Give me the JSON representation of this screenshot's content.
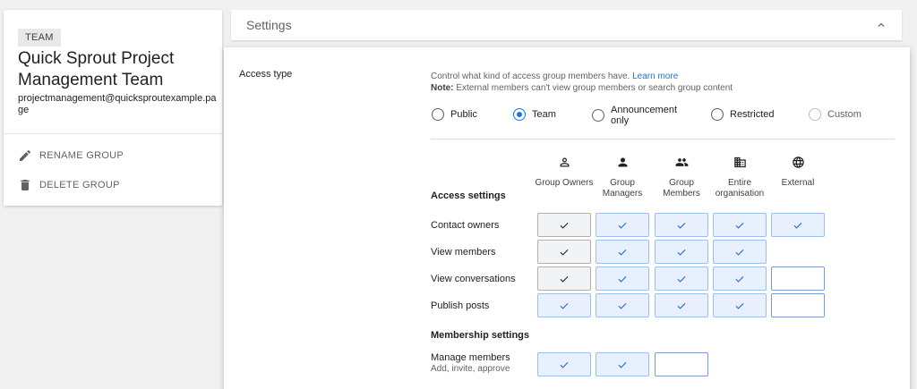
{
  "group": {
    "badge": "TEAM",
    "name": "Quick Sprout Project Management Team",
    "email": "projectmanagement@quicksproutexample.page",
    "actions": [
      {
        "label": "RENAME GROUP",
        "icon": "pencil-icon"
      },
      {
        "label": "DELETE GROUP",
        "icon": "trash-icon"
      }
    ]
  },
  "settings": {
    "title": "Settings",
    "access_type_label": "Access type",
    "description": "Control what kind of access group members have.",
    "learn_more": "Learn more",
    "note_label": "Note:",
    "note_text": "External members can't view group members or search group content",
    "access_options": [
      {
        "label": "Public",
        "selected": false,
        "disabled": false
      },
      {
        "label": "Team",
        "selected": true,
        "disabled": false
      },
      {
        "label": "Announcement only",
        "selected": false,
        "disabled": false
      },
      {
        "label": "Restricted",
        "selected": false,
        "disabled": false
      },
      {
        "label": "Custom",
        "selected": false,
        "disabled": true
      }
    ],
    "columns": [
      {
        "label": "Group Owners",
        "icon": "person-outline-icon"
      },
      {
        "label": "Group Managers",
        "icon": "person-icon"
      },
      {
        "label": "Group Members",
        "icon": "people-icon"
      },
      {
        "label": "Entire organisation",
        "icon": "building-icon"
      },
      {
        "label": "External",
        "icon": "globe-icon"
      }
    ],
    "access_settings_title": "Access settings",
    "access_rows": [
      {
        "label": "Contact owners",
        "cells": [
          "checked-locked",
          "checked",
          "checked",
          "checked",
          "checked"
        ]
      },
      {
        "label": "View members",
        "cells": [
          "checked-locked",
          "checked",
          "checked",
          "checked",
          "none"
        ]
      },
      {
        "label": "View conversations",
        "cells": [
          "checked-locked",
          "checked",
          "checked",
          "checked",
          "empty"
        ]
      },
      {
        "label": "Publish posts",
        "cells": [
          "checked",
          "checked",
          "checked",
          "checked",
          "empty"
        ]
      }
    ],
    "membership_settings_title": "Membership settings",
    "membership_rows": [
      {
        "label": "Manage members",
        "sublabel": "Add, invite, approve",
        "cells": [
          "checked",
          "checked",
          "empty"
        ]
      }
    ],
    "colors": {
      "accent": "#1a73e8",
      "cell_fill": "#e8f0fe",
      "check": "#1967d2"
    }
  }
}
